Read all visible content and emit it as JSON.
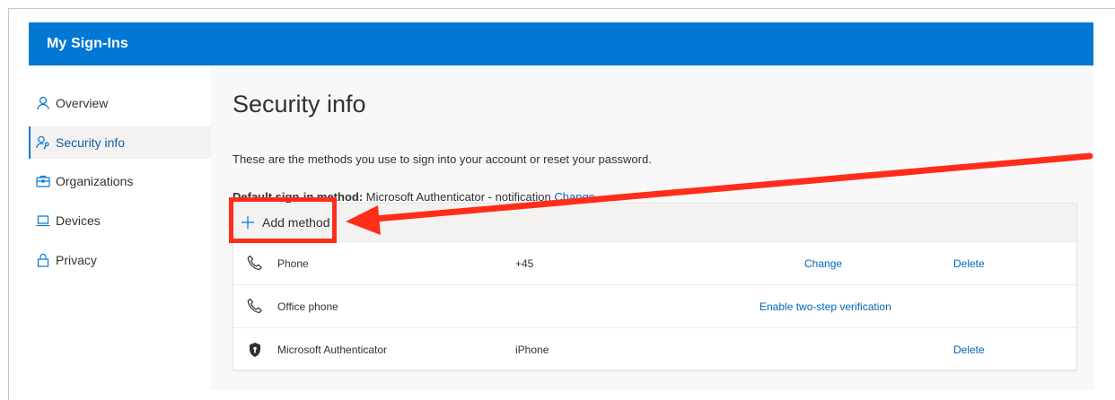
{
  "header": {
    "app_title": "My Sign-Ins"
  },
  "sidebar": {
    "items": [
      {
        "label": "Overview",
        "icon": "person-icon",
        "active": false
      },
      {
        "label": "Security info",
        "icon": "person-key-icon",
        "active": true
      },
      {
        "label": "Organizations",
        "icon": "briefcase-icon",
        "active": false
      },
      {
        "label": "Devices",
        "icon": "laptop-icon",
        "active": false
      },
      {
        "label": "Privacy",
        "icon": "lock-icon",
        "active": false
      }
    ]
  },
  "main": {
    "title": "Security info",
    "subtitle": "These are the methods you use to sign into your account or reset your password.",
    "default_method": {
      "label": "Default sign-in method:",
      "value": "Microsoft Authenticator - notification",
      "change_link": "Change"
    },
    "add_method_label": "Add method",
    "methods": [
      {
        "name": "Phone",
        "icon": "phone-icon",
        "detail": "+45",
        "action": "Change",
        "delete": "Delete"
      },
      {
        "name": "Office phone",
        "icon": "phone-icon",
        "detail": "",
        "action": "Enable two-step verification",
        "delete": ""
      },
      {
        "name": "Microsoft Authenticator",
        "icon": "authenticator-icon",
        "detail": "iPhone",
        "action": "",
        "delete": "Delete"
      }
    ]
  },
  "annotation": {
    "color": "#ff2d1a",
    "target": "Add method"
  },
  "colors": {
    "accent": "#0078d4",
    "link": "#0067b8",
    "annotation": "#ff2d1a"
  }
}
